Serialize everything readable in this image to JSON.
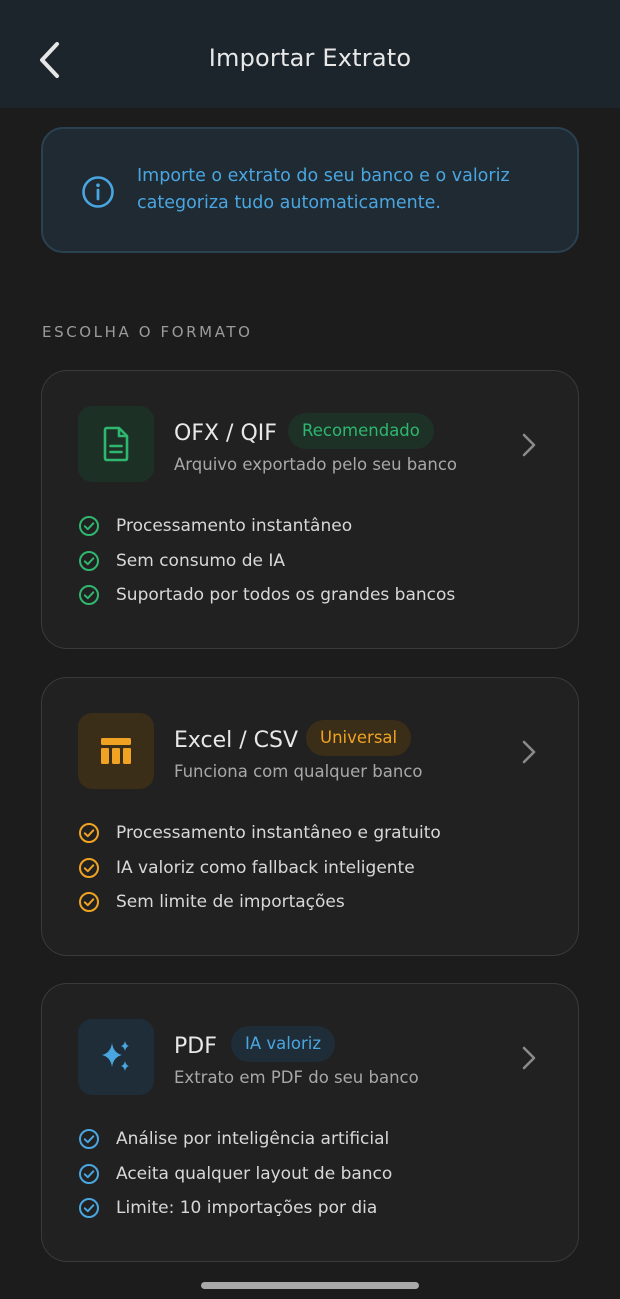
{
  "header": {
    "title": "Importar Extrato",
    "back_icon": "chevron-left-icon"
  },
  "info": {
    "icon": "info-icon",
    "text": "Importe o extrato do seu banco e o valoriz categoriza tudo automaticamente."
  },
  "section": {
    "title": "ESCOLHA O FORMATO"
  },
  "colors": {
    "green": "#2fb66f",
    "orange": "#f0a323",
    "blue": "#4aa6e0"
  },
  "cards": [
    {
      "title": "OFX / QIF",
      "badge": "Recomendado",
      "subtitle": "Arquivo exportado pelo seu banco",
      "icon": "document-icon",
      "features": [
        "Processamento instantâneo",
        "Sem consumo de IA",
        "Suportado por todos os grandes bancos"
      ]
    },
    {
      "title": "Excel / CSV",
      "badge": "Universal",
      "subtitle": "Funciona com qualquer banco",
      "icon": "table-icon",
      "features": [
        "Processamento instantâneo e gratuito",
        "IA valoriz como fallback inteligente",
        "Sem limite de importações"
      ]
    },
    {
      "title": "PDF",
      "badge": "IA valoriz",
      "subtitle": "Extrato em PDF do seu banco",
      "icon": "sparkles-icon",
      "features": [
        "Análise por inteligência artificial",
        "Aceita qualquer layout de banco",
        "Limite: 10 importações por dia"
      ]
    }
  ]
}
